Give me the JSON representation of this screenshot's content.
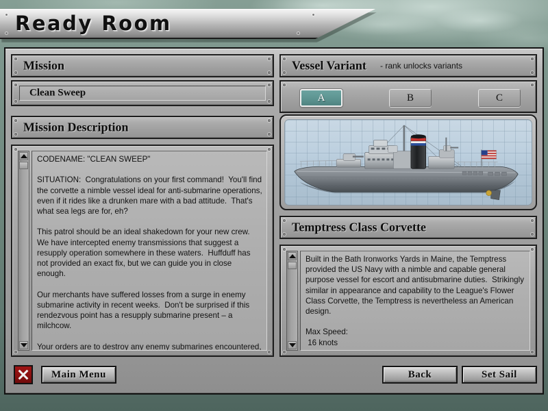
{
  "window": {
    "title": "Ready Room"
  },
  "left": {
    "mission_header": "Mission",
    "mission_name": "Clean Sweep",
    "description_header": "Mission Description",
    "description_text": "CODENAME: \"CLEAN SWEEP\"\n\nSITUATION:  Congratulations on your first command!  You'll find the corvette a nimble vessel ideal for anti-submarine operations, even if it rides like a drunken mare with a bad attitude.  That's what sea legs are for, eh?\n\nThis patrol should be an ideal shakedown for your new crew.  We have intercepted enemy transmissions that suggest a resupply operation somewhere in these waters.  Huffduff has not provided an exact fix, but we can guide you in close enough.\n\nOur merchants have suffered losses from a surge in enemy submarine activity in recent weeks.  Don't be surprised if this rendezvous point has a resupply submarine present – a milchcow.\n\nYour orders are to destroy any enemy submarines encountered, especially the milchcow, if one is present."
  },
  "right": {
    "variant_header": "Vessel Variant",
    "variant_hint": "- rank unlocks variants",
    "variants": [
      {
        "label": "A",
        "selected": true
      },
      {
        "label": "B",
        "selected": false
      },
      {
        "label": "C",
        "selected": false
      }
    ],
    "vessel_header": "Temptress Class Corvette",
    "vessel_text": "Built in the Bath Ironworks Yards in Maine, the Temptress provided the US Navy with a nimble and capable general purpose vessel for escort and antisubmarine duties.  Strikingly similar in appearance and capability to the League's Flower Class Corvette, the Temptress is nevertheless an American design.\n\nMax Speed:\n 16 knots\n\nMax range (flank):"
  },
  "footer": {
    "close_label": "✕",
    "main_menu_label": "Main Menu",
    "back_label": "Back",
    "set_sail_label": "Set Sail"
  },
  "colors": {
    "accent_selected": "#5d9491",
    "close_red": "#8a1010",
    "panel_gray": "#a8a8a8",
    "frame_black": "#121212",
    "bg_green": "#6f887e"
  }
}
